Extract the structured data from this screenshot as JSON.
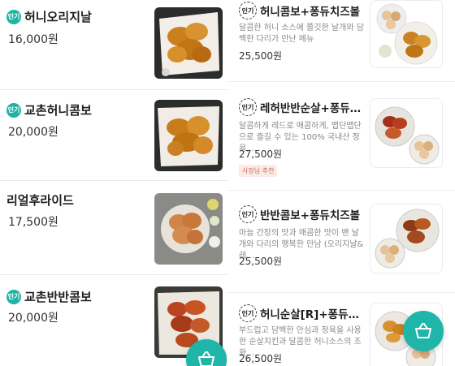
{
  "badge_label": "인기",
  "left_menu": [
    {
      "name": "허니오리지날",
      "price": "16,000원",
      "popular": true
    },
    {
      "name": "교촌허니콤보",
      "price": "20,000원",
      "popular": true
    },
    {
      "name": "리얼후라이드",
      "price": "17,500원",
      "popular": false
    },
    {
      "name": "교촌반반콤보",
      "price": "20,000원",
      "popular": true
    }
  ],
  "right_menu": [
    {
      "name": "허니콤보+퐁듀치즈볼",
      "desc": "달콤한 허니 소스에 쫄깃한 날개와 담백한 다리가 만난 메뉴",
      "price": "25,500원"
    },
    {
      "name": "레허반반순살+퐁듀…",
      "desc": "달콤하게 레드로 매콤하게, 맵단맵단으로 즐길 수 있는 100% 국내산 정육,…",
      "price": "27,500원",
      "tag": "사장님 추천"
    },
    {
      "name": "반반콤보+퐁듀치즈볼",
      "desc": "마늘 간장의 맛과 매콤한 맛이 밴 날개와 다리의 행복한 만남 (오리지날&레…",
      "price": "25,500원"
    },
    {
      "name": "허니순살[R]+퐁듀치…",
      "desc": "부드럽고 담백한 안심과 정육을 사용한 순살치킨과 달콤한 허니소스의 조화…",
      "price": "26,500원"
    }
  ],
  "colors": {
    "accent": "#1fb5a8",
    "tag_text": "#c46b57",
    "tag_bg": "#fbeae5"
  },
  "icons": {
    "cart": "basket-icon"
  }
}
